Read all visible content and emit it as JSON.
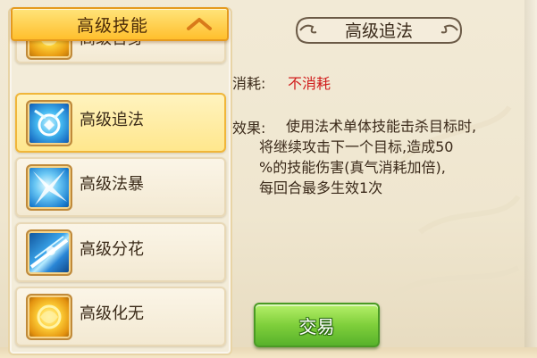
{
  "header": {
    "title": "高级技能",
    "caret_icon": "chevron-up-icon"
  },
  "skills": [
    {
      "label": "高级舍身",
      "icon": "golden-orb-icon",
      "selected": false
    },
    {
      "label": "高级追法",
      "icon": "blue-chase-icon",
      "selected": true
    },
    {
      "label": "高级法暴",
      "icon": "blue-burst-icon",
      "selected": false
    },
    {
      "label": "高级分花",
      "icon": "blue-split-icon",
      "selected": false
    },
    {
      "label": "高级化无",
      "icon": "golden-coin-icon",
      "selected": false
    }
  ],
  "detail": {
    "name": "高级追法",
    "cost_label": "消耗:",
    "cost_value": "不消耗",
    "effect_label": "效果:",
    "effect_lines": [
      "使用法术单体技能击杀目标时,",
      "将继续攻击下一个目标,造成50",
      "%的技能伤害(真气消耗加倍),",
      "每回合最多生效1次"
    ]
  },
  "actions": {
    "trade_label": "交易"
  },
  "colors": {
    "accent_gold": "#ffbf2d",
    "cost_red": "#d01c1c",
    "button_green": "#7fcf3b"
  }
}
